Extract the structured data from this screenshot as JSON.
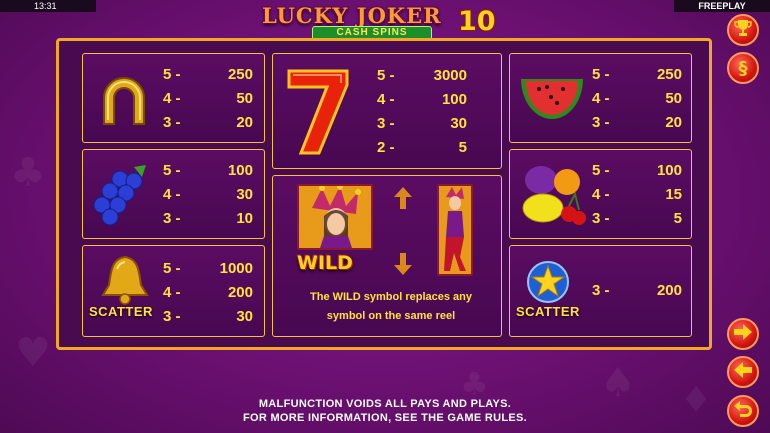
{
  "status": {
    "clock": "13:31",
    "mode": "FREEPLAY"
  },
  "logo": {
    "title": "LUCKY JOKER",
    "number": "10",
    "subtitle": "CASH SPINS"
  },
  "paytable": {
    "horseshoe": {
      "icon": "horseshoe-icon",
      "pays": [
        {
          "count": "5 -",
          "value": "250"
        },
        {
          "count": "4 -",
          "value": "50"
        },
        {
          "count": "3 -",
          "value": "20"
        }
      ]
    },
    "seven": {
      "icon": "seven-icon",
      "pays": [
        {
          "count": "5 -",
          "value": "3000"
        },
        {
          "count": "4 -",
          "value": "100"
        },
        {
          "count": "3 -",
          "value": "30"
        },
        {
          "count": "2 -",
          "value": "5"
        }
      ]
    },
    "watermelon": {
      "icon": "watermelon-icon",
      "pays": [
        {
          "count": "5 -",
          "value": "250"
        },
        {
          "count": "4 -",
          "value": "50"
        },
        {
          "count": "3 -",
          "value": "20"
        }
      ]
    },
    "grapes": {
      "icon": "grapes-icon",
      "pays": [
        {
          "count": "5 -",
          "value": "100"
        },
        {
          "count": "4 -",
          "value": "30"
        },
        {
          "count": "3 -",
          "value": "10"
        }
      ]
    },
    "fruits": {
      "icon": "fruits-icon",
      "pays": [
        {
          "count": "5 -",
          "value": "100"
        },
        {
          "count": "4 -",
          "value": "15"
        },
        {
          "count": "3 -",
          "value": "5"
        }
      ]
    },
    "bell": {
      "icon": "bell-icon",
      "label": "SCATTER",
      "pays": [
        {
          "count": "5 -",
          "value": "1000"
        },
        {
          "count": "4 -",
          "value": "200"
        },
        {
          "count": "3 -",
          "value": "30"
        }
      ]
    },
    "star": {
      "icon": "star-icon",
      "label": "SCATTER",
      "pays": [
        {
          "count": "3 -",
          "value": "200"
        }
      ]
    },
    "wild": {
      "label": "WILD",
      "description_line1": "The WILD symbol replaces any",
      "description_line2": "symbol on the same reel"
    }
  },
  "sidebar": {
    "trophy_icon": "trophy-icon",
    "rules_icon": "section-icon",
    "next_icon": "arrow-right-icon",
    "prev_icon": "arrow-left-icon",
    "back_icon": "return-icon"
  },
  "footer": {
    "line1": "MALFUNCTION VOIDS ALL PAYS AND PLAYS.",
    "line2": "FOR MORE INFORMATION, SEE THE GAME RULES."
  },
  "colors": {
    "background": "#6c1072",
    "border": "#f3a91f",
    "payout_text": "#ffe23a",
    "button": "#d4150f"
  }
}
